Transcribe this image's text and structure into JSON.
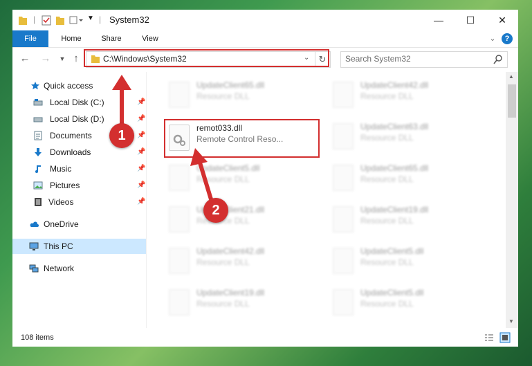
{
  "window": {
    "title": "System32",
    "controls": {
      "minimize": "—",
      "maximize": "☐",
      "close": "✕"
    }
  },
  "ribbon": {
    "tabs": [
      "File",
      "Home",
      "Share",
      "View"
    ],
    "expand_glyph": "⌄",
    "help_glyph": "?"
  },
  "navbar": {
    "address": "C:\\Windows\\System32",
    "search_placeholder": "Search System32"
  },
  "sidebar": {
    "items": [
      {
        "label": "Quick access",
        "icon": "star-icon",
        "pinned": false
      },
      {
        "label": "Local Disk (C:)",
        "icon": "drive-icon",
        "pinned": true
      },
      {
        "label": "Local Disk (D:)",
        "icon": "drive-icon",
        "pinned": true
      },
      {
        "label": "Documents",
        "icon": "documents-icon",
        "pinned": true
      },
      {
        "label": "Downloads",
        "icon": "download-icon",
        "pinned": true
      },
      {
        "label": "Music",
        "icon": "music-icon",
        "pinned": true
      },
      {
        "label": "Pictures",
        "icon": "pictures-icon",
        "pinned": true
      },
      {
        "label": "Videos",
        "icon": "videos-icon",
        "pinned": true
      },
      {
        "label": "OneDrive",
        "icon": "onedrive-icon",
        "pinned": false
      },
      {
        "label": "This PC",
        "icon": "pc-icon",
        "pinned": false,
        "selected": true
      },
      {
        "label": "Network",
        "icon": "network-icon",
        "pinned": false
      }
    ]
  },
  "files": {
    "left": [
      {
        "name": "UpdateClient65.dll",
        "desc": "Resource DLL"
      },
      {
        "name": "remot033.dll",
        "desc": "Remote Control Reso...",
        "highlighted": true
      },
      {
        "name": "UpdateClient5.dll",
        "desc": "Resource DLL"
      },
      {
        "name": "UpdateClient21.dll",
        "desc": "Resource DLL"
      },
      {
        "name": "UpdateClient42.dll",
        "desc": "Resource DLL"
      },
      {
        "name": "UpdateClient19.dll",
        "desc": "Resource DLL"
      }
    ],
    "right": [
      {
        "name": "UpdateClient42.dll",
        "desc": "Resource DLL"
      },
      {
        "name": "UpdateClient63.dll",
        "desc": "Resource DLL"
      },
      {
        "name": "UpdateClient65.dll",
        "desc": "Resource DLL"
      },
      {
        "name": "UpdateClient19.dll",
        "desc": "Resource DLL"
      },
      {
        "name": "UpdateClient5.dll",
        "desc": "Resource DLL"
      },
      {
        "name": "UpdateClient5.dll",
        "desc": "Resource DLL"
      }
    ]
  },
  "status": {
    "item_count": "108 items"
  },
  "annotations": {
    "step1": "1",
    "step2": "2",
    "color": "#d32f2f"
  }
}
